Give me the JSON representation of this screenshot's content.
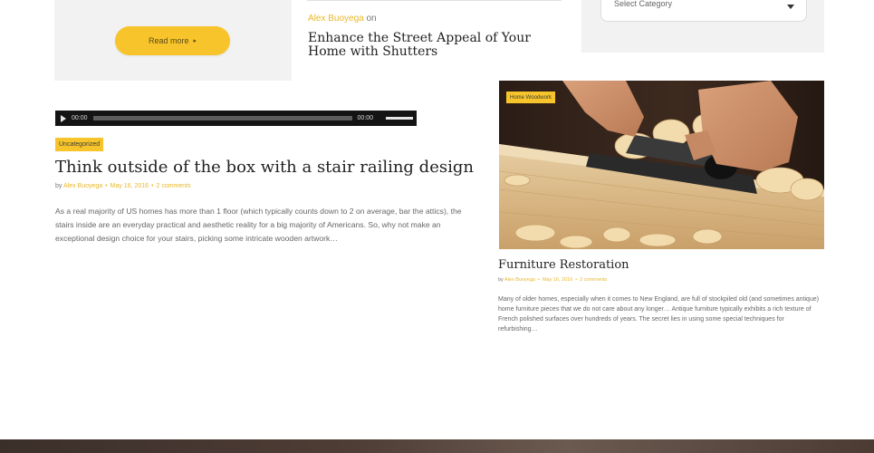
{
  "card": {
    "read_more": "Read more"
  },
  "related": {
    "author": "Alex Buoyega",
    "on": "on",
    "title": "Enhance the Street Appeal of Your Home with Shutters"
  },
  "sidebar": {
    "category_select": "Select Category"
  },
  "audio": {
    "current": "00:00",
    "duration": "00:00"
  },
  "post1": {
    "category": "Uncategorized",
    "title": "Think outside of the box with a stair railing design",
    "by": "by",
    "author": "Alex Buoyega",
    "date": "May 16, 2016",
    "comments": "2 comments",
    "excerpt": "As a real majority of US homes has more than 1 floor (which typically counts down to 2 on average, bar the attics), the stairs inside are an everyday practical and aesthetic reality for a big majority of Americans. So, why not make an exceptional design choice for your stairs, picking some intricate wooden artwork…"
  },
  "post2": {
    "category": "Home Woodwork",
    "title": "Furniture Restoration",
    "by": "by",
    "author": "Alex Buoyega",
    "date": "May 16, 2016",
    "comments": "2 comments",
    "excerpt": "Many of older homes, especially when it comes to New England, are full of stockpiled old (and sometimes antique) home furniture pieces that we do not care about any longer… Antique furniture typically exhibits a rich texture of French polished surfaces over hundreds of years. The secret lies in using some special techniques for refurbishing…"
  },
  "colors": {
    "accent": "#f7c52b",
    "link": "#e8b82c",
    "title": "#222222",
    "footer": "#4e3d35"
  }
}
